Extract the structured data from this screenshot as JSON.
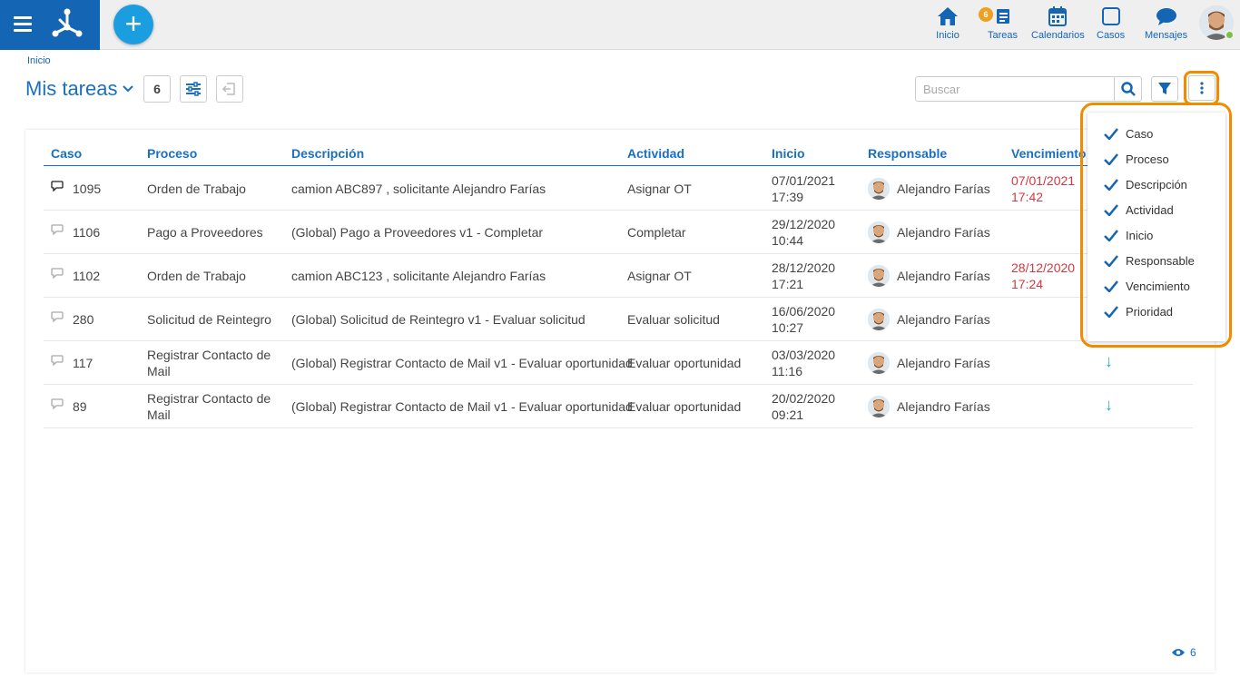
{
  "topbar": {
    "nav": [
      {
        "label": "Inicio",
        "icon": "home-icon"
      },
      {
        "label": "Tareas",
        "icon": "tasks-icon",
        "badge": "6"
      },
      {
        "label": "Calendarios",
        "icon": "calendar-icon"
      },
      {
        "label": "Casos",
        "icon": "cases-icon"
      },
      {
        "label": "Mensajes",
        "icon": "messages-icon"
      }
    ],
    "brand_color": "#1565b5",
    "add_label": "+"
  },
  "breadcrumb": "Inicio",
  "page_title": "Mis tareas",
  "task_count": "6",
  "search": {
    "placeholder": "Buscar"
  },
  "table": {
    "headers": [
      "Caso",
      "Proceso",
      "Descripción",
      "Actividad",
      "Inicio",
      "Responsable",
      "Vencimiento"
    ],
    "rows": [
      {
        "caso": "1095",
        "proceso": [
          "Orden de Trabajo",
          ""
        ],
        "descripcion": "camion ABC897 , solicitante Alejandro Farías",
        "actividad": "Asignar OT",
        "inicio": [
          "07/01/2021",
          "17:39"
        ],
        "responsable": "Alejandro Farías",
        "vencimiento": [
          "07/01/2021",
          "17:42"
        ],
        "unread": true,
        "prioridad": ""
      },
      {
        "caso": "1106",
        "proceso": [
          "Pago a Proveedores",
          ""
        ],
        "descripcion": "(Global) Pago a Proveedores v1 - Completar",
        "actividad": "Completar",
        "inicio": [
          "29/12/2020",
          "10:44"
        ],
        "responsable": "Alejandro Farías",
        "vencimiento": [
          "",
          ""
        ],
        "unread": false,
        "prioridad": ""
      },
      {
        "caso": "1102",
        "proceso": [
          "Orden de Trabajo",
          ""
        ],
        "descripcion": "camion ABC123 , solicitante Alejandro Farías",
        "actividad": "Asignar OT",
        "inicio": [
          "28/12/2020",
          "17:21"
        ],
        "responsable": "Alejandro Farías",
        "vencimiento": [
          "28/12/2020",
          "17:24"
        ],
        "unread": false,
        "prioridad": ""
      },
      {
        "caso": "280",
        "proceso": [
          "Solicitud de Reintegro",
          ""
        ],
        "descripcion": "(Global) Solicitud de Reintegro v1 - Evaluar solicitud",
        "actividad": "Evaluar solicitud",
        "inicio": [
          "16/06/2020",
          "10:27"
        ],
        "responsable": "Alejandro Farías",
        "vencimiento": [
          "",
          ""
        ],
        "unread": false,
        "prioridad": ""
      },
      {
        "caso": "117",
        "proceso": [
          "Registrar Contacto de",
          "Mail"
        ],
        "descripcion": "(Global) Registrar Contacto de Mail v1 - Evaluar oportunidad",
        "actividad": "Evaluar oportunidad",
        "inicio": [
          "03/03/2020",
          "11:16"
        ],
        "responsable": "Alejandro Farías",
        "vencimiento": [
          "",
          ""
        ],
        "unread": false,
        "prioridad": "↓"
      },
      {
        "caso": "89",
        "proceso": [
          "Registrar Contacto de",
          "Mail"
        ],
        "descripcion": "(Global) Registrar Contacto de Mail v1 - Evaluar oportunidad",
        "actividad": "Evaluar oportunidad",
        "inicio": [
          "20/02/2020",
          "09:21"
        ],
        "responsable": "Alejandro Farías",
        "vencimiento": [
          "",
          ""
        ],
        "unread": false,
        "prioridad": "↓"
      }
    ]
  },
  "column_menu": {
    "items": [
      "Caso",
      "Proceso",
      "Descripción",
      "Actividad",
      "Inicio",
      "Responsable",
      "Vencimiento",
      "Prioridad"
    ]
  },
  "footer": {
    "views": "6"
  },
  "colors": {
    "accent": "#1a6fc0",
    "highlight": "#f08c00",
    "overdue": "#d9363e"
  }
}
